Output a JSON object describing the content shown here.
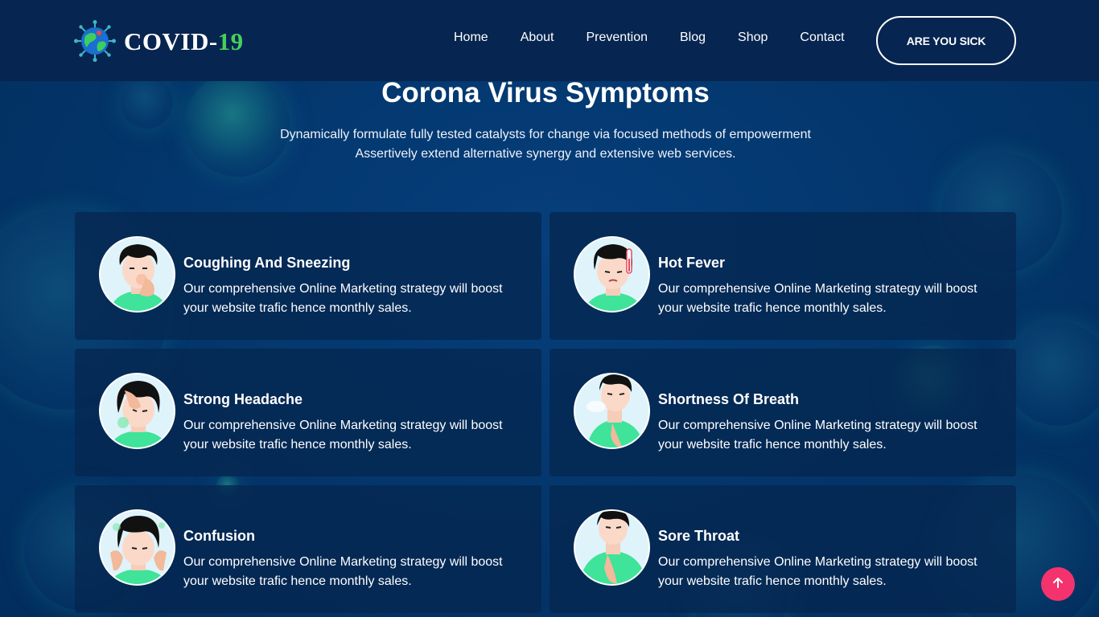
{
  "brand": {
    "name_main": "COVID-",
    "name_accent": "19",
    "icon": "globe-virus-icon"
  },
  "nav": {
    "items": [
      "Home",
      "About",
      "Prevention",
      "Blog",
      "Shop",
      "Contact"
    ],
    "cta": "ARE YOU SICK"
  },
  "section": {
    "title": "Corona Virus Symptoms",
    "subtitle_line1": "Dynamically formulate fully tested catalysts for change via focused methods of empowerment",
    "subtitle_line2": "Assertively extend alternative synergy and extensive web services."
  },
  "cards": [
    {
      "title": "Coughing And Sneezing",
      "desc": "Our comprehensive Online Marketing strategy will boost your website trafic hence monthly sales.",
      "icon": "coughing-person-icon"
    },
    {
      "title": "Hot Fever",
      "desc": "Our comprehensive Online Marketing strategy will boost your website trafic hence monthly sales.",
      "icon": "fever-person-icon"
    },
    {
      "title": "Strong Headache",
      "desc": "Our comprehensive Online Marketing strategy will boost your website trafic hence monthly sales.",
      "icon": "headache-person-icon"
    },
    {
      "title": "Shortness Of Breath",
      "desc": "Our comprehensive Online Marketing strategy will boost your website trafic hence monthly sales.",
      "icon": "breathless-person-icon"
    },
    {
      "title": "Confusion",
      "desc": "Our comprehensive Online Marketing strategy will boost your website trafic hence monthly sales.",
      "icon": "confused-person-icon"
    },
    {
      "title": "Sore Throat",
      "desc": "Our comprehensive Online Marketing strategy will boost your website trafic hence monthly sales.",
      "icon": "sore-throat-person-icon"
    }
  ],
  "scroll_top": {
    "icon": "arrow-up-icon"
  },
  "colors": {
    "background": "#02386f",
    "header": "#062550",
    "accent_green": "#46d05a",
    "scroll_button": "#f3326e"
  }
}
